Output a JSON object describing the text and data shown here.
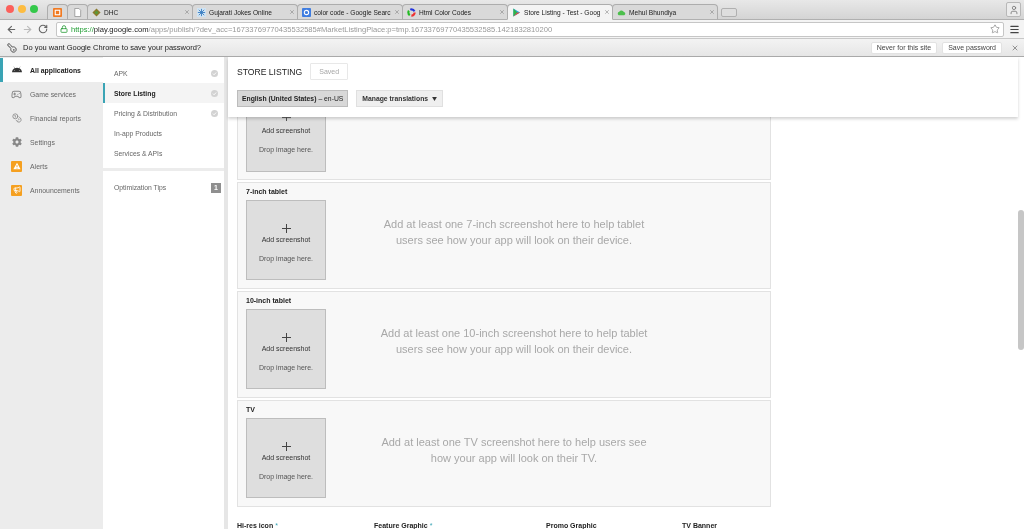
{
  "browser": {
    "tabs": [
      {
        "kind": "narrow",
        "selected": false
      },
      {
        "kind": "narrow",
        "selected": false
      },
      {
        "kind": "page",
        "title": "DHC",
        "selected": false
      },
      {
        "kind": "page",
        "title": "Gujarati Jokes Online",
        "selected": false
      },
      {
        "kind": "page",
        "title": "color code - Google Searc",
        "selected": false
      },
      {
        "kind": "page",
        "title": "Html Color Codes",
        "selected": false
      },
      {
        "kind": "page",
        "title": "Store Listing - Test - Goog",
        "selected": true
      },
      {
        "kind": "page",
        "title": "Mehul Bhundiya",
        "selected": false
      }
    ],
    "address": {
      "scheme": "https://",
      "host": "play.google.com",
      "path": "/apps/publish/?dev_acc=16733769770435532585#MarketListingPlace:p=tmp.16733769770435532585.1421832810200"
    },
    "password_bar": {
      "message": "Do you want Google Chrome to save your password?",
      "buttons": [
        "Never for this site",
        "Save password"
      ]
    }
  },
  "app_nav": {
    "items": [
      {
        "label": "All applications",
        "selected": true
      },
      {
        "label": "Game services",
        "selected": false
      },
      {
        "label": "Financial reports",
        "selected": false
      },
      {
        "label": "Settings",
        "selected": false
      },
      {
        "label": "Alerts",
        "selected": false
      },
      {
        "label": "Announcements",
        "selected": false
      }
    ]
  },
  "section_nav": {
    "items": [
      {
        "label": "APK",
        "selected": false,
        "done": true
      },
      {
        "label": "Store Listing",
        "selected": true,
        "done": true
      },
      {
        "label": "Pricing & Distribution",
        "selected": false,
        "done": true
      },
      {
        "label": "In-app Products",
        "selected": false,
        "done": false
      },
      {
        "label": "Services & APIs",
        "selected": false,
        "done": false
      }
    ],
    "tips": {
      "label": "Optimization Tips",
      "count": "1"
    }
  },
  "header": {
    "title": "STORE LISTING",
    "save_button": {
      "label": "Saved",
      "disabled": true
    },
    "language": {
      "name": "English (United States)",
      "code": "– en-US"
    },
    "translations_button": "Manage translations"
  },
  "screenshot_sections": [
    {
      "kind": "clipped",
      "upload": {
        "label": "Add screenshot",
        "hint": "Drop image here."
      }
    },
    {
      "kind": "full",
      "title": "7-inch tablet",
      "upload": {
        "label": "Add screenshot",
        "hint": "Drop image here."
      },
      "message": "Add at least one 7-inch screenshot here to help tablet users see how your app will look on their device."
    },
    {
      "kind": "full",
      "title": "10-inch tablet",
      "upload": {
        "label": "Add screenshot",
        "hint": "Drop image here."
      },
      "message": "Add at least one 10-inch screenshot here to help tablet users see how your app will look on their device."
    },
    {
      "kind": "full",
      "title": "TV",
      "upload": {
        "label": "Add screenshot",
        "hint": "Drop image here."
      },
      "message": "Add at least one TV screenshot here to help users see how your app will look on their TV."
    }
  ],
  "graphics": [
    {
      "label": "Hi-res icon",
      "mark": "*"
    },
    {
      "label": "Feature Graphic",
      "mark": "*"
    },
    {
      "label": "Promo Graphic"
    },
    {
      "label": "TV Banner"
    }
  ]
}
